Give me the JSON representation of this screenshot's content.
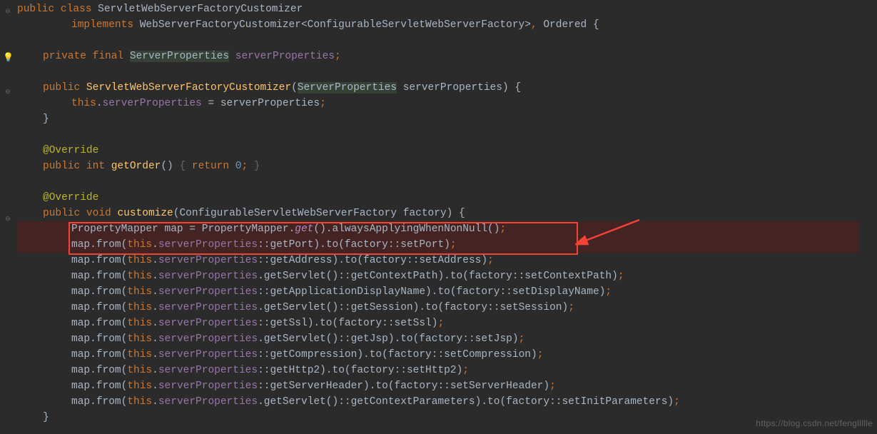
{
  "watermark": "https://blog.csdn.net/fengllllle",
  "gutter": {
    "bulb": "💡"
  },
  "tokens": {
    "public": "public",
    "class": "class",
    "implements": "implements",
    "private": "private",
    "final": "final",
    "void": "void",
    "int": "int",
    "this": "this",
    "return": "return",
    "className": "ServletWebServerFactoryCustomizer",
    "iface": "WebServerFactoryCustomizer",
    "generic": "ConfigurableServletWebServerFactory",
    "ordered": "Ordered",
    "propsType": "ServerProperties",
    "propsField": "serverProperties",
    "override": "@Override",
    "getOrder": "getOrder",
    "zero": "0",
    "customize": "customize",
    "factoryParam": "factory",
    "mapperType": "PropertyMapper",
    "mapVar": "map",
    "getStatic": "get",
    "always": "alwaysApplyingWhenNonNull",
    "from": "from",
    "to": "to",
    "getServlet": "getServlet"
  },
  "map_lines": [
    {
      "getter": "getPort",
      "via": "ref",
      "setter": "setPort"
    },
    {
      "getter": "getAddress",
      "via": "ref",
      "setter": "setAddress"
    },
    {
      "getter": "getContextPath",
      "via": "servlet",
      "setter": "setContextPath"
    },
    {
      "getter": "getApplicationDisplayName",
      "via": "ref",
      "setter": "setDisplayName",
      "toArg": "factory"
    },
    {
      "getter": "getSession",
      "via": "servlet",
      "setter": "setSession"
    },
    {
      "getter": "getSsl",
      "via": "ref",
      "setter": "setSsl"
    },
    {
      "getter": "getJsp",
      "via": "servlet",
      "setter": "setJsp"
    },
    {
      "getter": "getCompression",
      "via": "ref",
      "setter": "setCompression"
    },
    {
      "getter": "getHttp2",
      "via": "ref",
      "setter": "setHttp2"
    },
    {
      "getter": "getServerHeader",
      "via": "ref",
      "setter": "setServerHeader"
    },
    {
      "getter": "getContextParameters",
      "via": "servlet",
      "setter": "setInitParameters"
    }
  ]
}
